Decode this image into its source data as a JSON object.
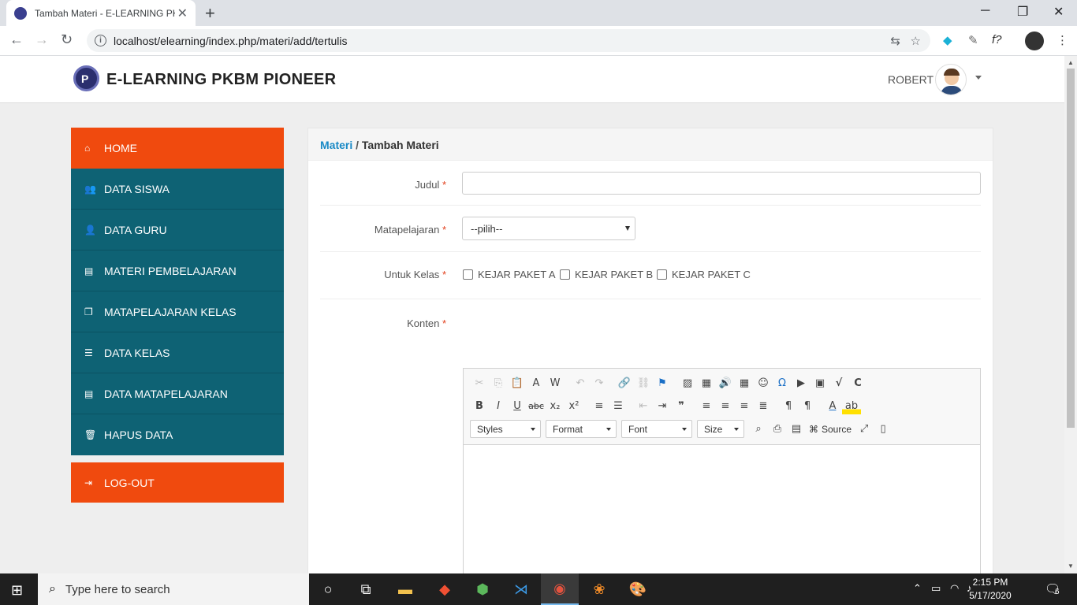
{
  "browser": {
    "tab_title": "Tambah Materi - E-LEARNING PK",
    "tab_close": "✕",
    "new_tab": "+",
    "url": "localhost/elearning/index.php/materi/add/tertulis",
    "minimize": "─",
    "restore": "❐",
    "close": "✕"
  },
  "header": {
    "brand": "E-LEARNING PKBM PIONEER",
    "logo_letter": "P",
    "user_name": "ROBERT"
  },
  "sidebar": {
    "items": [
      {
        "label": "HOME",
        "icon": "home-icon",
        "glyph": "⌂"
      },
      {
        "label": "DATA SISWA",
        "icon": "users-icon",
        "glyph": "👥"
      },
      {
        "label": "DATA GURU",
        "icon": "user-icon",
        "glyph": "👤"
      },
      {
        "label": "MATERI PEMBELAJARAN",
        "icon": "book-icon",
        "glyph": "▤"
      },
      {
        "label": "MATAPELAJARAN KELAS",
        "icon": "copy-icon",
        "glyph": "❐"
      },
      {
        "label": "DATA KELAS",
        "icon": "list-icon",
        "glyph": "☰"
      },
      {
        "label": "DATA MATAPELAJARAN",
        "icon": "book-icon",
        "glyph": "▤"
      },
      {
        "label": "HAPUS DATA",
        "icon": "trash-icon",
        "glyph": "🗑"
      }
    ],
    "logout": {
      "label": "LOG-OUT",
      "icon": "logout-icon",
      "glyph": "⇥"
    }
  },
  "breadcrumb": {
    "link": "Materi",
    "separator": "/",
    "current": "Tambah Materi"
  },
  "form": {
    "required_mark": "*",
    "judul_label": "Judul",
    "judul_value": "",
    "matapelajaran_label": "Matapelajaran",
    "matapelajaran_selected": "--pilih--",
    "kelas_label": "Untuk Kelas",
    "kelas_options": [
      "KEJAR PAKET A",
      "KEJAR PAKET B",
      "KEJAR PAKET C"
    ],
    "konten_label": "Konten"
  },
  "editor": {
    "combos": [
      "Styles",
      "Format",
      "Font",
      "Size"
    ],
    "source_label": "Source"
  },
  "taskbar": {
    "search_placeholder": "Type here to search",
    "time": "2:15 PM",
    "date": "5/17/2020",
    "notifications": "6"
  },
  "colors": {
    "accent_orange": "#f04a0e",
    "sidebar_teal": "#0e6274",
    "link_blue": "#1a8ac6"
  }
}
